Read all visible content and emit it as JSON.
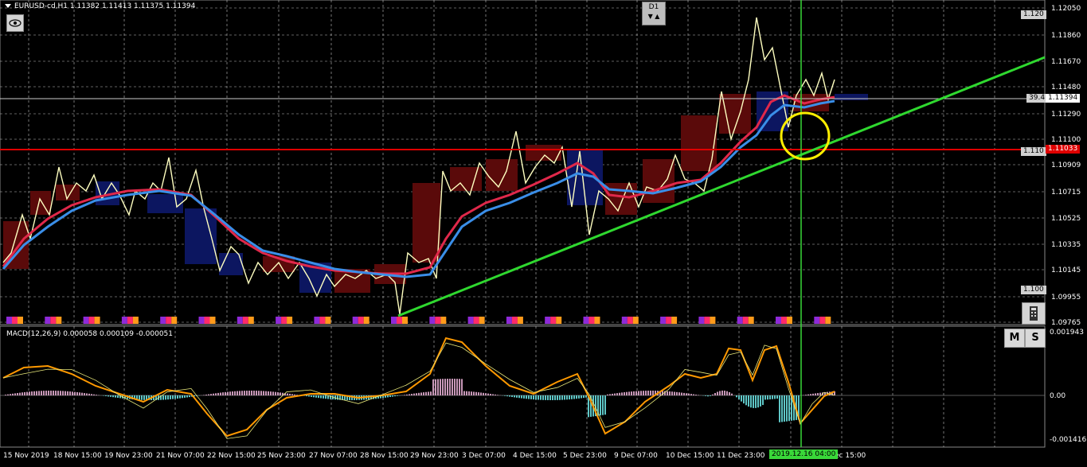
{
  "header": {
    "symbol_info": "EURUSD-cd,H1  1.11382 1.11413 1.11375 1.11394",
    "timeframe_badge": "D1",
    "arrow_down": "▼",
    "arrow_up": "▲"
  },
  "indicator": {
    "label": "MACD(12,26,9) 0.000058 0.000109 -0.000051"
  },
  "price_axis": {
    "labels": [
      "1.12050",
      "1.11860",
      "1.11670",
      "1.11480",
      "1.11290",
      "1.11100",
      "1.10909",
      "1.10715",
      "1.10525",
      "1.10335",
      "1.10145",
      "1.09955",
      "1.09765"
    ],
    "level_top": "1.120",
    "level_mid": "1.110",
    "level_low": "1.100",
    "current_price": "1.11394",
    "red_line_price": "1.11033",
    "left_hint": "39.4"
  },
  "macd_axis": {
    "labels": [
      "0.001943",
      "0.00",
      "-0.001416"
    ]
  },
  "time_axis": {
    "labels": [
      "15 Nov 2019",
      "18 Nov 15:00",
      "19 Nov 23:00",
      "21 Nov 07:00",
      "22 Nov 15:00",
      "25 Nov 23:00",
      "27 Nov 07:00",
      "28 Nov 15:00",
      "29 Nov 23:00",
      "3 Dec 07:00",
      "4 Dec 15:00",
      "5 Dec 23:00",
      "9 Dec 07:00",
      "10 Dec 15:00",
      "11 Dec 23:00",
      "ec 15:00"
    ],
    "crosshair_time": "2019.12.16 04:00"
  },
  "buttons": {
    "m_label": "M",
    "s_label": "S"
  },
  "colors": {
    "background": "#000000",
    "grid": "#c0c0c0",
    "price_line": "#ffffc0",
    "ma_red": "#e0284a",
    "ma_blue": "#3a8ee8",
    "trendline": "#2fd82f",
    "support_line": "#e00000",
    "highlight_circle": "#ffee00",
    "crosshair": "#39d839",
    "histogram": "#5ec6c6",
    "signal": "#ff9900"
  }
}
